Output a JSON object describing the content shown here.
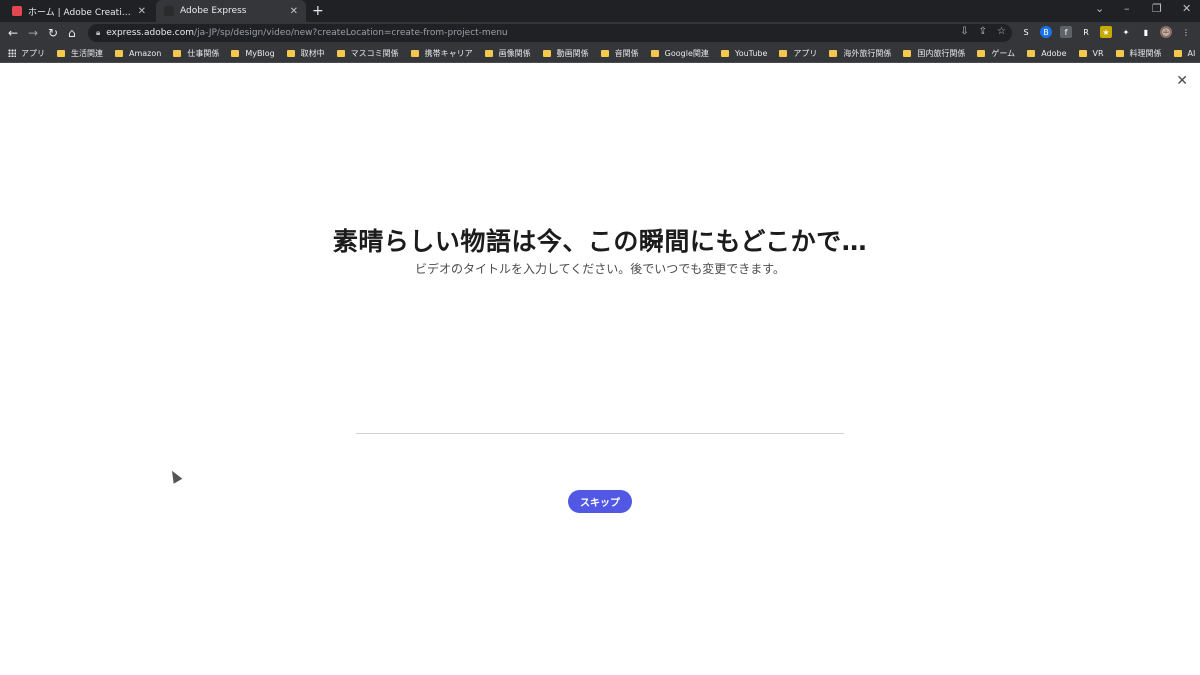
{
  "browser": {
    "tabs": [
      {
        "title": "ホーム | Adobe Creative Cloud",
        "active": false,
        "favicon_color": "#e34850"
      },
      {
        "title": "Adobe Express",
        "active": true,
        "favicon_color": "#2b2b2b"
      }
    ],
    "new_tab_icon": "plus-icon",
    "window_controls": {
      "chevron": "⌄",
      "minimize": "–",
      "restore": "❐",
      "close": "✕"
    },
    "nav": {
      "back": "←",
      "forward": "→",
      "reload": "↻",
      "home": "⌂"
    },
    "url_host": "express.adobe.com",
    "url_path": "/ja-JP/sp/design/video/new?createLocation=create-from-project-menu",
    "omnibox_icons": [
      "install-icon",
      "share-icon",
      "star-icon"
    ],
    "extensions": [
      {
        "label": "S",
        "color": "#35363a"
      },
      {
        "label": "B",
        "color": "#1a73e8"
      },
      {
        "label": "f",
        "color": "#5f6368"
      },
      {
        "label": "R",
        "color": "#35363a"
      },
      {
        "label": "★",
        "color": "#c8a900"
      },
      {
        "label": "✦",
        "color": "#35363a"
      },
      {
        "label": "▮",
        "color": "#35363a"
      },
      {
        "label": "☺",
        "color": "#8d6e63"
      },
      {
        "label": "⋮",
        "color": "#35363a"
      }
    ]
  },
  "bookmarks": [
    "アプリ",
    "生活関連",
    "Amazon",
    "仕事関係",
    "MyBlog",
    "取材中",
    "マスコミ関係",
    "携帯キャリア",
    "画像関係",
    "動画関係",
    "音関係",
    "Google関連",
    "YouTube",
    "アプリ",
    "海外旅行関係",
    "国内旅行関係",
    "ゲーム",
    "Adobe",
    "VR",
    "料理関係",
    "AI"
  ],
  "page": {
    "close_icon": "✕",
    "headline": "素晴らしい物語は今、この瞬間にもどこかで…",
    "subline": "ビデオのタイトルを入力してください。後でいつでも変更できます。",
    "title_input_value": "",
    "skip_label": "スキップ",
    "accent": "#5258e4"
  }
}
